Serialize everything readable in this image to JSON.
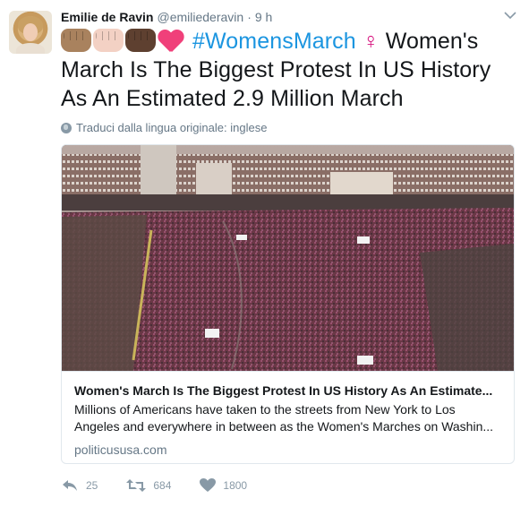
{
  "author": {
    "name": "Emilie de Ravin",
    "handle": "@emiliederavin",
    "separator": "·",
    "time": "9 h"
  },
  "tweet": {
    "emojis": [
      "oncoming-fist-medium-skin",
      "oncoming-fist-light-skin",
      "oncoming-fist-dark-skin",
      "growing-heart"
    ],
    "hashtag": "#WomensMarch",
    "female_sign": "♀",
    "body": "Women's March Is The Biggest Protest In US History As An Estimated 2.9 Million March"
  },
  "translate": {
    "label": "Traduci dalla lingua originale: inglese",
    "icon": "globe-icon"
  },
  "card": {
    "image_alt": "aerial-crowd-photo",
    "title": "Women's March Is The Biggest Protest In US History As An Estimate...",
    "description": "Millions of Americans have taken to the streets from New York to Los Angeles and everywhere in between as the Women's Marches on Washin...",
    "domain": "politicususa.com"
  },
  "actions": {
    "replies": "25",
    "retweets": "684",
    "likes": "1800"
  },
  "colors": {
    "link": "#1b95e0",
    "venus": "#d6127e",
    "muted": "#657786",
    "icon": "#8899a6"
  }
}
